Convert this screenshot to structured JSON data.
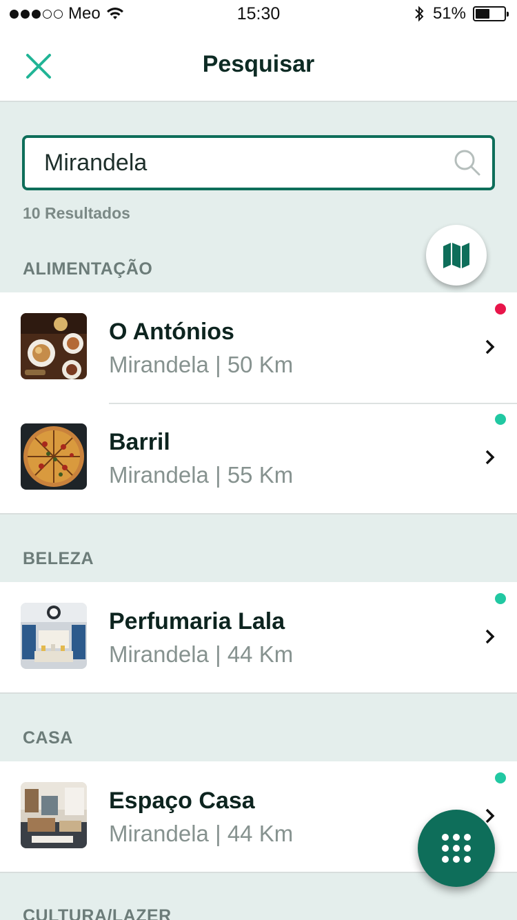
{
  "status_bar": {
    "carrier": "Meo",
    "time": "15:30",
    "battery": "51%",
    "battery_level": 0.51,
    "signal_bars": 3,
    "signal_total": 5
  },
  "nav": {
    "title": "Pesquisar",
    "close_icon": "close-icon"
  },
  "search": {
    "value": "Mirandela",
    "placeholder": "",
    "results_count": "10 Resultados"
  },
  "colors": {
    "accent": "#0e6e5a",
    "closed": "#e8154a",
    "open": "#21c8a2",
    "background": "#e4eeec"
  },
  "sections": [
    {
      "title": "ALIMENTAÇÃO",
      "items": [
        {
          "name": "O Antónios",
          "subtitle": "Mirandela | 50 Km",
          "status": "closed",
          "thumb": "restaurant-table-photo"
        },
        {
          "name": "Barril",
          "subtitle": "Mirandela | 55 Km",
          "status": "open",
          "thumb": "pizza-photo"
        }
      ]
    },
    {
      "title": "BELEZA",
      "items": [
        {
          "name": "Perfumaria Lala",
          "subtitle": "Mirandela | 44 Km",
          "status": "open",
          "thumb": "perfumery-store-photo"
        }
      ]
    },
    {
      "title": "CASA",
      "items": [
        {
          "name": "Espaço Casa",
          "subtitle": "Mirandela | 44 Km",
          "status": "open",
          "thumb": "home-store-photo"
        }
      ]
    },
    {
      "title": "CULTURA/LAZER",
      "items": []
    }
  ]
}
